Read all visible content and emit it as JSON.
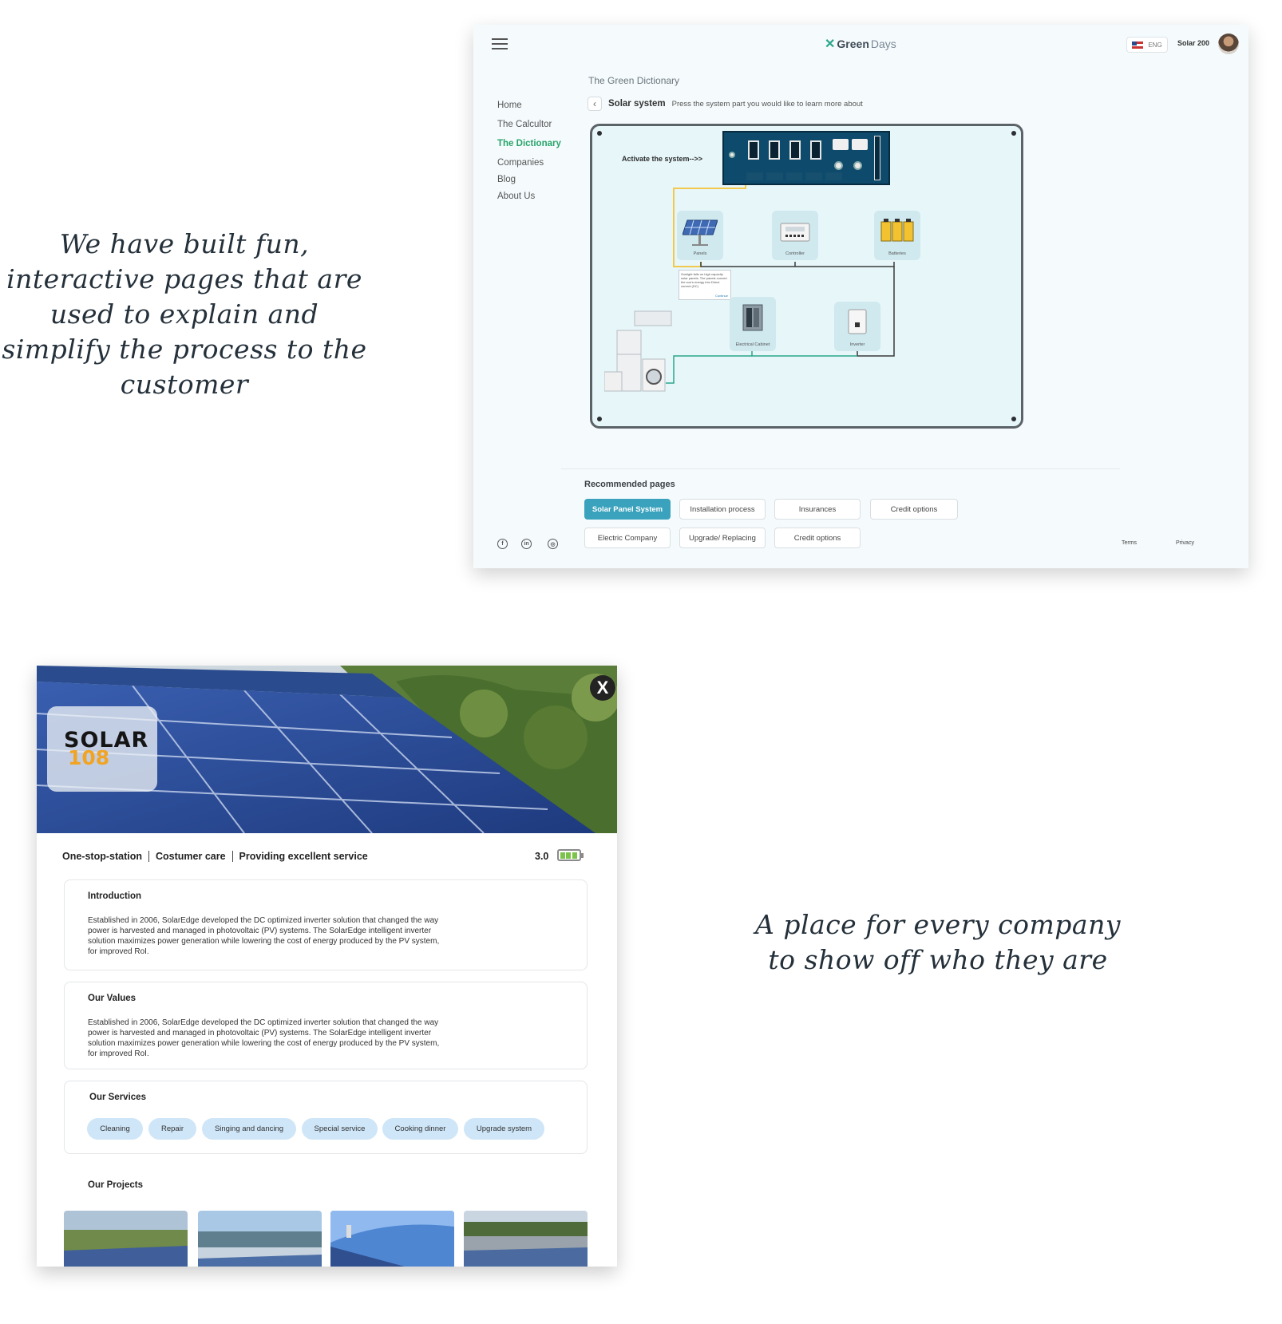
{
  "captions": {
    "top_left": "We have built fun, interactive pages that are used to explain and simplify the process to the customer",
    "bottom_right": "A place for every company to show off who they are"
  },
  "dictionary_page": {
    "brand": {
      "name_bold": "Green",
      "name_light": "Days"
    },
    "header": {
      "language": "ENG",
      "user": "Solar 200"
    },
    "nav": [
      {
        "label": "Home",
        "active": false
      },
      {
        "label": "The Calcultor",
        "active": false
      },
      {
        "label": "The Dictionary",
        "active": true
      },
      {
        "label": "Companies",
        "active": false
      },
      {
        "label": "Blog",
        "active": false
      },
      {
        "label": "About Us",
        "active": false
      }
    ],
    "title": "The Green Dictionary",
    "breadcrumb": {
      "system": "Solar system",
      "hint": "Press the system part you would like to learn more about"
    },
    "board": {
      "activate_label": "Activate the system-->>",
      "components": [
        "Panels",
        "Controller",
        "Batteries",
        "Electrical Cabinet",
        "Inverter"
      ],
      "tooltip": {
        "text": "Sunlight falls on high capacity solar panels. The panels convert the sun's energy into Direct current (DC)",
        "link": "Continue"
      }
    },
    "recommended": {
      "title": "Recommended pages",
      "items": [
        "Solar Panel System",
        "Installation process",
        "Insurances",
        "Credit options",
        "Electric Company",
        "Upgrade/ Replacing",
        "Credit options"
      ]
    },
    "footer": {
      "social": [
        "facebook",
        "linkedin",
        "instagram"
      ],
      "links": [
        "Terms",
        "Privacy"
      ]
    }
  },
  "company_page": {
    "logo": {
      "line1": "SOLAR",
      "line2": "108"
    },
    "close_label": "X",
    "tags": [
      "One-stop-station",
      "Costumer care",
      "Providing excellent service"
    ],
    "rating": "3.0",
    "rating_fraction": 0.6,
    "introduction": {
      "title": "Introduction",
      "text": "Established in 2006, SolarEdge developed the DC optimized inverter solution that changed the way power is harvested and managed in photovoltaic (PV) systems. The SolarEdge intelligent inverter solution maximizes power generation while lowering the cost of energy produced by the PV system, for improved RoI."
    },
    "values": {
      "title": "Our Values",
      "text": "Established in 2006, SolarEdge developed the DC optimized inverter solution that changed the way power is harvested and managed in photovoltaic (PV) systems. The SolarEdge intelligent inverter solution maximizes power generation while lowering the cost of energy produced by the PV system, for improved RoI."
    },
    "services": {
      "title": "Our Services",
      "items": [
        "Cleaning",
        "Repair",
        "Singing and dancing",
        "Special service",
        "Cooking dinner",
        "Upgrade system"
      ]
    },
    "projects": {
      "title": "Our Projects"
    }
  },
  "colors": {
    "accent": "#28a36a",
    "chip_active": "#3aa2bd",
    "service_chip": "#cfe6f8",
    "battery": "#7cc34c",
    "logo_orange": "#f1a424"
  }
}
